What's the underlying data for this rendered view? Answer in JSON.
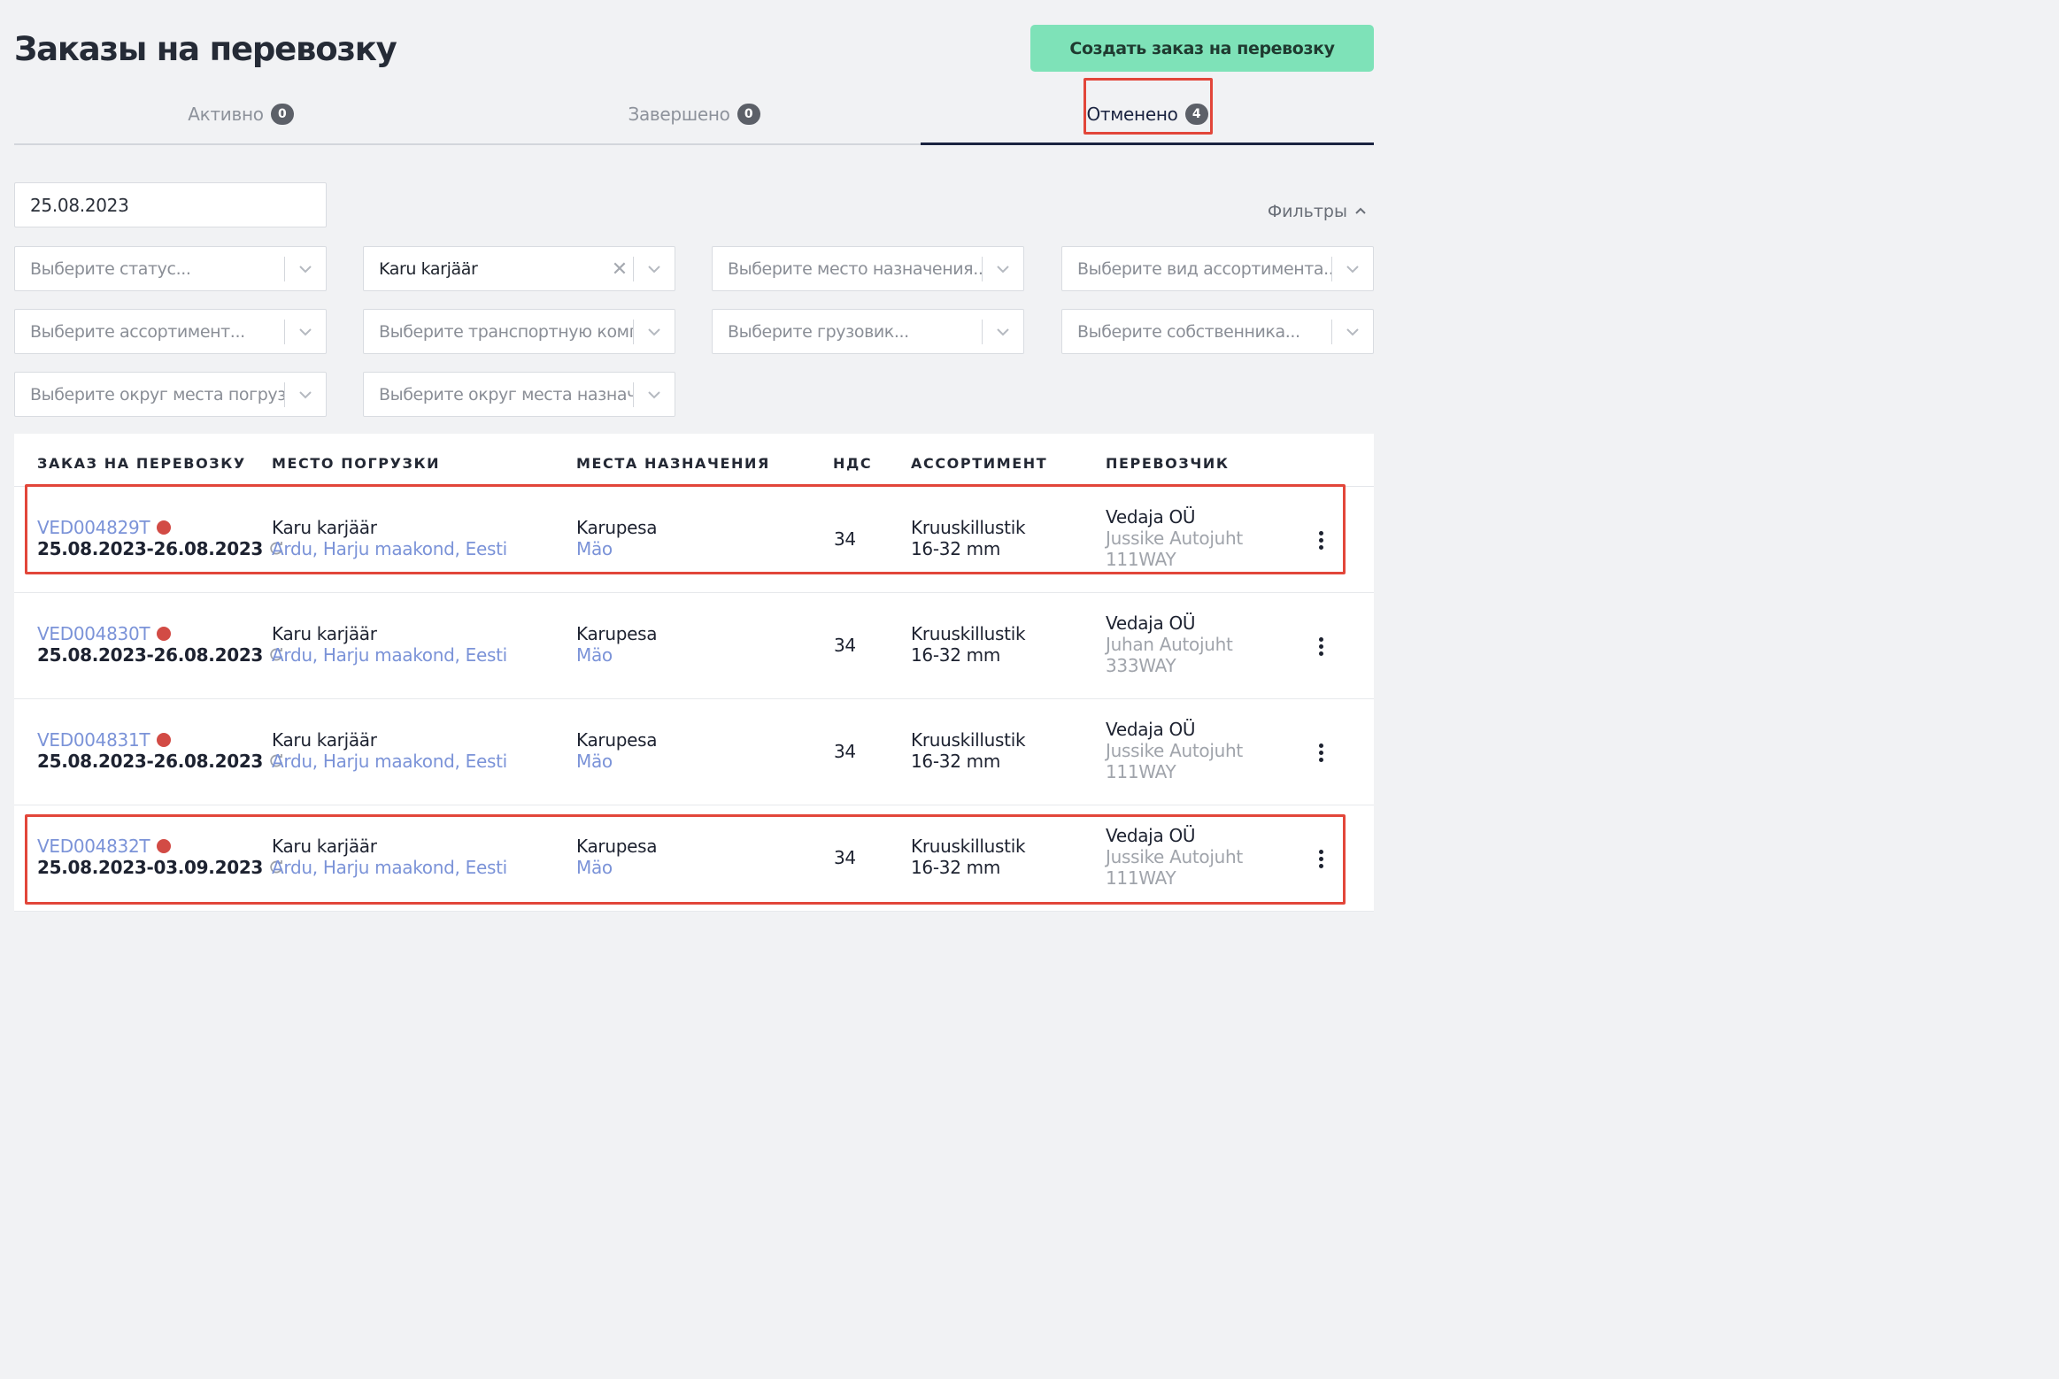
{
  "header": {
    "title": "Заказы на перевозку",
    "create_button": "Создать заказ на перевозку"
  },
  "tabs": [
    {
      "label": "Активно",
      "count": "0"
    },
    {
      "label": "Завершено",
      "count": "0"
    },
    {
      "label": "Отменено",
      "count": "4"
    }
  ],
  "filters": {
    "date": "25.08.2023",
    "toggle_label": "Фильтры",
    "selects": [
      {
        "text": "Выберите статус...",
        "filled": false
      },
      {
        "text": "Karu karjäär",
        "filled": true
      },
      {
        "text": "Выберите место назначения...",
        "filled": false
      },
      {
        "text": "Выберите вид ассортимента...",
        "filled": false
      },
      {
        "text": "Выберите ассортимент...",
        "filled": false
      },
      {
        "text": "Выберите транспортную компанию...",
        "filled": false
      },
      {
        "text": "Выберите грузовик...",
        "filled": false
      },
      {
        "text": "Выберите собственника...",
        "filled": false
      },
      {
        "text": "Выберите округ места погрузки...",
        "filled": false
      },
      {
        "text": "Выберите округ места назначения...",
        "filled": false
      }
    ]
  },
  "table": {
    "headers": [
      "ЗАКАЗ НА ПЕРЕВОЗКУ",
      "МЕСТО ПОГРУЗКИ",
      "МЕСТА НАЗНАЧЕНИЯ",
      "НДС",
      "АССОРТИМЕНТ",
      "ПЕРЕВОЗЧИК"
    ],
    "rows": [
      {
        "order": "VED004829T",
        "dates": "25.08.2023-26.08.2023",
        "load_place": "Karu karjäär",
        "load_address": "Ardu, Harju maakond, Eesti",
        "dest": "Karupesa",
        "dest_sub": "Mäo",
        "vat": "34",
        "assort1": "Kruuskillustik",
        "assort2": "16-32 mm",
        "carrier": "Vedaja OÜ",
        "driver": "Jussike Autojuht",
        "truck": "111WAY"
      },
      {
        "order": "VED004830T",
        "dates": "25.08.2023-26.08.2023",
        "load_place": "Karu karjäär",
        "load_address": "Ardu, Harju maakond, Eesti",
        "dest": "Karupesa",
        "dest_sub": "Mäo",
        "vat": "34",
        "assort1": "Kruuskillustik",
        "assort2": "16-32 mm",
        "carrier": "Vedaja OÜ",
        "driver": "Juhan Autojuht",
        "truck": "333WAY"
      },
      {
        "order": "VED004831T",
        "dates": "25.08.2023-26.08.2023",
        "load_place": "Karu karjäär",
        "load_address": "Ardu, Harju maakond, Eesti",
        "dest": "Karupesa",
        "dest_sub": "Mäo",
        "vat": "34",
        "assort1": "Kruuskillustik",
        "assort2": "16-32 mm",
        "carrier": "Vedaja OÜ",
        "driver": "Jussike Autojuht",
        "truck": "111WAY"
      },
      {
        "order": "VED004832T",
        "dates": "25.08.2023-03.09.2023",
        "load_place": "Karu karjäär",
        "load_address": "Ardu, Harju maakond, Eesti",
        "dest": "Karupesa",
        "dest_sub": "Mäo",
        "vat": "34",
        "assort1": "Kruuskillustik",
        "assort2": "16-32 mm",
        "carrier": "Vedaja OÜ",
        "driver": "Jussike Autojuht",
        "truck": "111WAY"
      }
    ]
  },
  "colors": {
    "accent": "#7ee2b8",
    "link": "#7b93d8",
    "status_dot": "#d24b45",
    "highlight": "#e2463a"
  }
}
